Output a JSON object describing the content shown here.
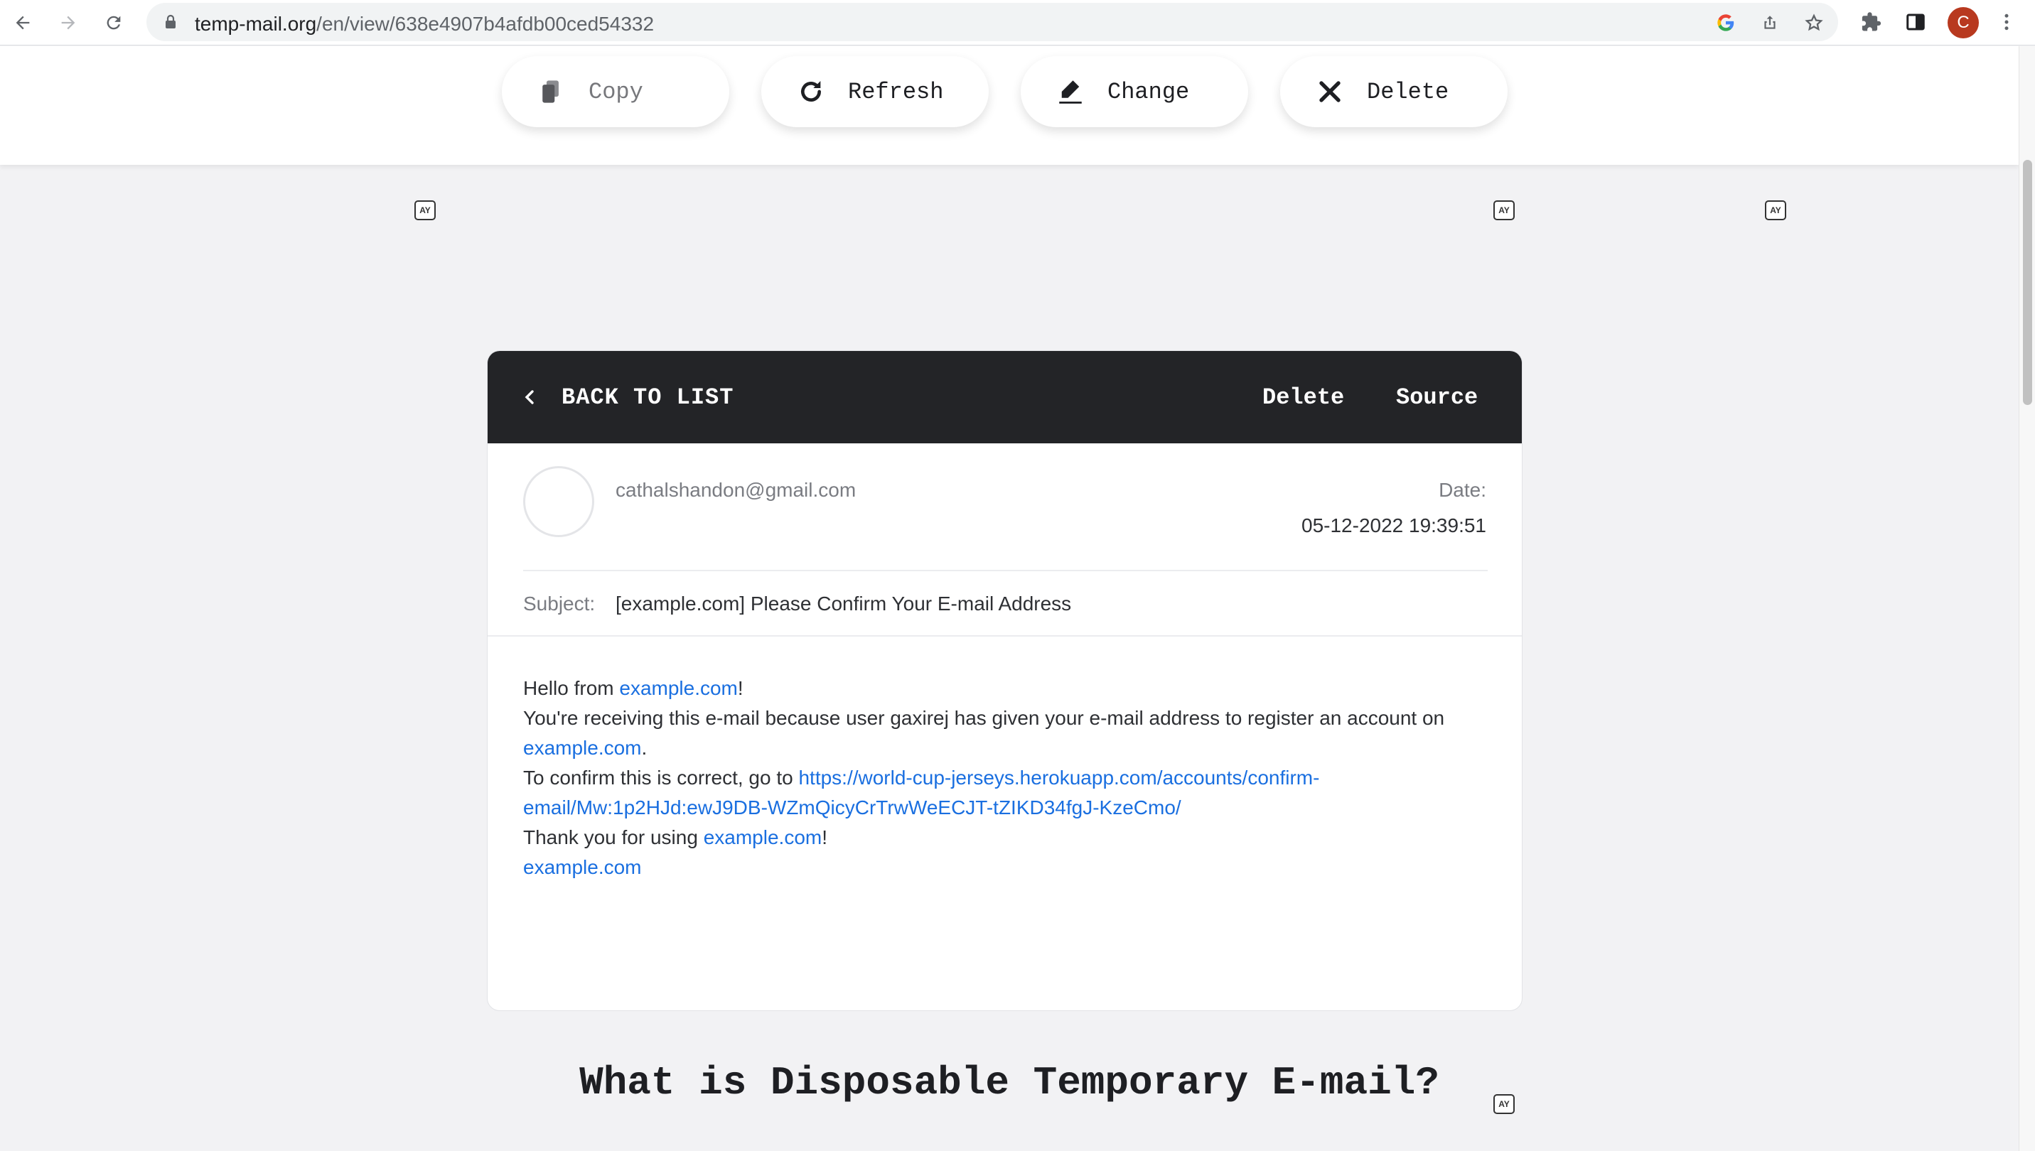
{
  "browser": {
    "url_host": "temp-mail.org",
    "url_path": "/en/view/638e4907b4afdb00ced54332",
    "profile_initial": "C",
    "icons": [
      "back-arrow-icon",
      "forward-arrow-icon",
      "reload-icon",
      "lock-icon",
      "google-icon",
      "share-icon",
      "star-icon",
      "extensions-icon",
      "side-panel-icon",
      "kebab-menu-icon"
    ]
  },
  "toolbar": {
    "copy_label": "Copy",
    "refresh_label": "Refresh",
    "change_label": "Change",
    "delete_label": "Delete"
  },
  "ad_badge": "AY",
  "email": {
    "back_label": "BACK TO LIST",
    "delete_label": "Delete",
    "source_label": "Source",
    "sender": "cathalshandon@gmail.com",
    "date_label": "Date:",
    "date_value": "05-12-2022 19:39:51",
    "subject_label": "Subject:",
    "subject": "[example.com] Please Confirm Your E-mail Address",
    "body": {
      "greeting_prefix": "Hello from ",
      "greeting_link": "example.com",
      "greeting_suffix": "!",
      "line2": "You're receiving this e-mail because user gaxirej has given your e-mail address to register an account on",
      "line2_link": "example.com",
      "line2_suffix": ".",
      "confirm_prefix": "To confirm this is correct, go to ",
      "confirm_link_1": "https://world-cup-jerseys.herokuapp.com/accounts/confirm-",
      "confirm_link_2": "email/Mw:1p2HJd:ewJ9DB-WZmQicyCrTrwWeECJT-tZIKD34fgJ-KzeCmo/",
      "thanks_prefix": "Thank you for using ",
      "thanks_link": "example.com",
      "thanks_suffix": "!",
      "signature_link": "example.com"
    }
  },
  "faq_heading": "What is Disposable Temporary E-mail?",
  "colors": {
    "page_bg": "#f2f2f4",
    "card_header": "#232427",
    "link": "#1a6fe0",
    "avatar": "#b8391f"
  }
}
